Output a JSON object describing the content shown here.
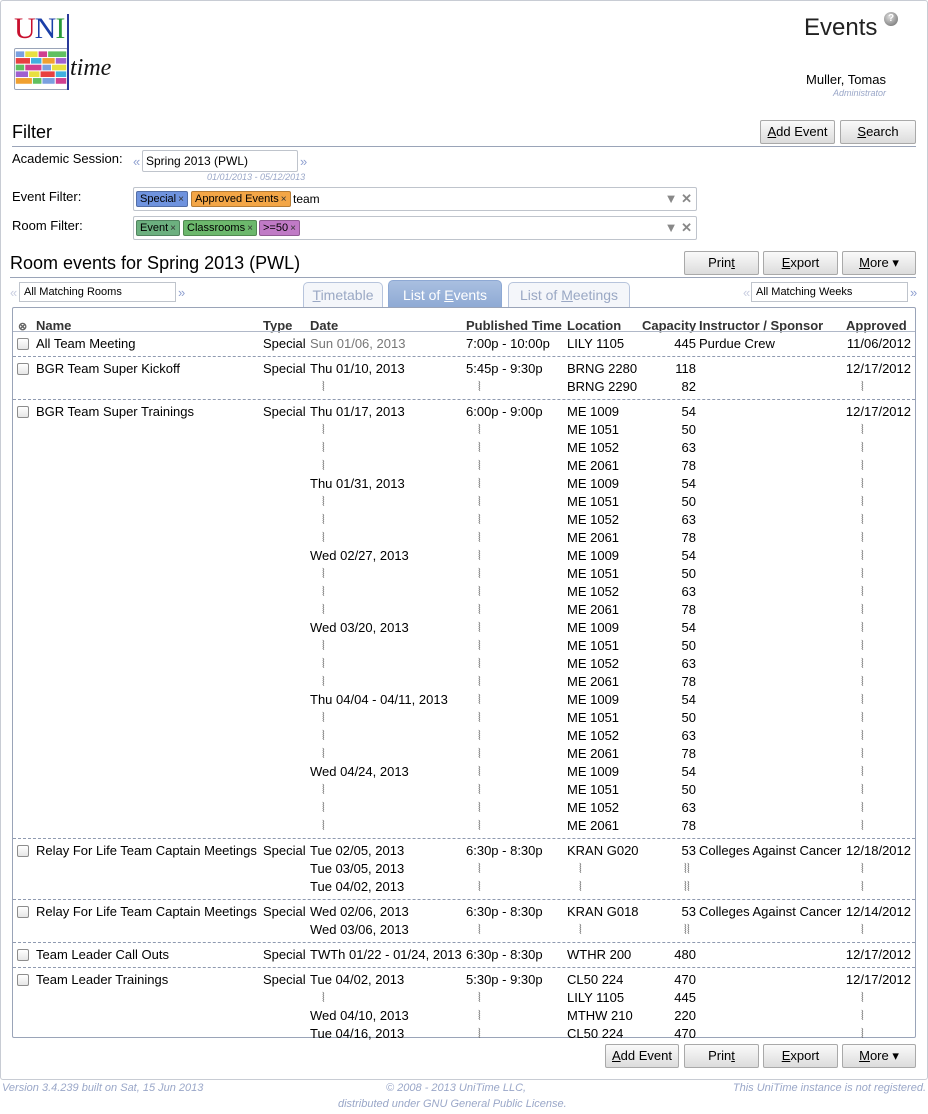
{
  "header": {
    "logo_uni": "UNI",
    "logo_time": "time",
    "title": "Events",
    "help_glyph": "?",
    "user_name": "Muller, Tomas",
    "user_role": "Administrator"
  },
  "filter": {
    "title": "Filter",
    "add_event": "Add Event",
    "search": "Search",
    "session_label": "Academic Session:",
    "session_value": "Spring 2013 (PWL)",
    "session_dates": "01/01/2013 - 05/12/2013",
    "event_filter_label": "Event Filter:",
    "event_chips": [
      {
        "text": "Special",
        "color": "#6f93de"
      },
      {
        "text": "Approved Events",
        "color": "#f3a647"
      }
    ],
    "event_text": "team",
    "room_filter_label": "Room Filter:",
    "room_chips": [
      {
        "text": "Event",
        "color": "#6cb07f"
      },
      {
        "text": "Classrooms",
        "color": "#6cb86c"
      },
      {
        "text": ">=50",
        "color": "#c07ac6"
      }
    ]
  },
  "results": {
    "title": "Room events for Spring 2013 (PWL)",
    "print": "Print",
    "export": "Export",
    "more": "More ▾",
    "rooms_select": "All Matching Rooms",
    "weeks_select": "All Matching Weeks",
    "tabs": [
      "Timetable",
      "List of Events",
      "List of Meetings"
    ],
    "active_tab": 1,
    "columns": [
      "Name",
      "Type",
      "Date",
      "Published Time",
      "Location",
      "Capacity",
      "Instructor / Sponsor",
      "Approved"
    ],
    "ditto": "⦚"
  },
  "events": [
    {
      "name": "All Team Meeting",
      "type": "Special",
      "sponsor": "Purdue Crew",
      "approved": "11/06/2012",
      "meetings": [
        {
          "date": "Sun 01/06, 2013",
          "date_past": true,
          "time": "7:00p - 10:00p",
          "location": "LILY 1105",
          "capacity": "445"
        }
      ]
    },
    {
      "name": "BGR Team Super Kickoff",
      "type": "Special",
      "sponsor": "",
      "approved": "12/17/2012",
      "meetings": [
        {
          "date": "Thu 01/10, 2013",
          "time": "5:45p - 9:30p",
          "location": "BRNG 2280",
          "capacity": "118"
        },
        {
          "date": "",
          "time": "",
          "location": "BRNG 2290",
          "capacity": "82"
        }
      ]
    },
    {
      "name": "BGR Team Super Trainings",
      "type": "Special",
      "sponsor": "",
      "approved": "12/17/2012",
      "meetings": [
        {
          "date": "Thu 01/17, 2013",
          "time": "6:00p - 9:00p",
          "location": "ME 1009",
          "capacity": "54"
        },
        {
          "date": "",
          "time": "",
          "location": "ME 1051",
          "capacity": "50"
        },
        {
          "date": "",
          "time": "",
          "location": "ME 1052",
          "capacity": "63"
        },
        {
          "date": "",
          "time": "",
          "location": "ME 2061",
          "capacity": "78"
        },
        {
          "date": "Thu 01/31, 2013",
          "time": "",
          "location": "ME 1009",
          "capacity": "54"
        },
        {
          "date": "",
          "time": "",
          "location": "ME 1051",
          "capacity": "50"
        },
        {
          "date": "",
          "time": "",
          "location": "ME 1052",
          "capacity": "63"
        },
        {
          "date": "",
          "time": "",
          "location": "ME 2061",
          "capacity": "78"
        },
        {
          "date": "Wed 02/27, 2013",
          "time": "",
          "location": "ME 1009",
          "capacity": "54"
        },
        {
          "date": "",
          "time": "",
          "location": "ME 1051",
          "capacity": "50"
        },
        {
          "date": "",
          "time": "",
          "location": "ME 1052",
          "capacity": "63"
        },
        {
          "date": "",
          "time": "",
          "location": "ME 2061",
          "capacity": "78"
        },
        {
          "date": "Wed 03/20, 2013",
          "time": "",
          "location": "ME 1009",
          "capacity": "54"
        },
        {
          "date": "",
          "time": "",
          "location": "ME 1051",
          "capacity": "50"
        },
        {
          "date": "",
          "time": "",
          "location": "ME 1052",
          "capacity": "63"
        },
        {
          "date": "",
          "time": "",
          "location": "ME 2061",
          "capacity": "78"
        },
        {
          "date": "Thu 04/04 - 04/11, 2013",
          "time": "",
          "location": "ME 1009",
          "capacity": "54"
        },
        {
          "date": "",
          "time": "",
          "location": "ME 1051",
          "capacity": "50"
        },
        {
          "date": "",
          "time": "",
          "location": "ME 1052",
          "capacity": "63"
        },
        {
          "date": "",
          "time": "",
          "location": "ME 2061",
          "capacity": "78"
        },
        {
          "date": "Wed 04/24, 2013",
          "time": "",
          "location": "ME 1009",
          "capacity": "54"
        },
        {
          "date": "",
          "time": "",
          "location": "ME 1051",
          "capacity": "50"
        },
        {
          "date": "",
          "time": "",
          "location": "ME 1052",
          "capacity": "63"
        },
        {
          "date": "",
          "time": "",
          "location": "ME 2061",
          "capacity": "78"
        }
      ]
    },
    {
      "name": "Relay For Life Team Captain Meetings",
      "type": "Special",
      "sponsor": "Colleges Against Cancer",
      "approved": "12/18/2012",
      "meetings": [
        {
          "date": "Tue 02/05, 2013",
          "time": "6:30p - 8:30p",
          "location": "KRAN G020",
          "capacity": "53"
        },
        {
          "date": "Tue 03/05, 2013",
          "time": "",
          "location": "",
          "capacity": ""
        },
        {
          "date": "Tue 04/02, 2013",
          "time": "",
          "location": "",
          "capacity": ""
        }
      ]
    },
    {
      "name": "Relay For Life Team Captain Meetings",
      "type": "Special",
      "sponsor": "Colleges Against Cancer",
      "approved": "12/14/2012",
      "meetings": [
        {
          "date": "Wed 02/06, 2013",
          "time": "6:30p - 8:30p",
          "location": "KRAN G018",
          "capacity": "53"
        },
        {
          "date": "Wed 03/06, 2013",
          "time": "",
          "location": "",
          "capacity": ""
        }
      ]
    },
    {
      "name": "Team Leader Call Outs",
      "type": "Special",
      "sponsor": "",
      "approved": "12/17/2012",
      "meetings": [
        {
          "date": "TWTh 01/22 - 01/24, 2013",
          "time": "6:30p - 8:30p",
          "location": "WTHR 200",
          "capacity": "480"
        }
      ]
    },
    {
      "name": "Team Leader Trainings",
      "type": "Special",
      "sponsor": "",
      "approved": "12/17/2012",
      "meetings": [
        {
          "date": "Tue 04/02, 2013",
          "time": "5:30p - 9:30p",
          "location": "CL50 224",
          "capacity": "470"
        },
        {
          "date": "",
          "time": "",
          "location": "LILY 1105",
          "capacity": "445"
        },
        {
          "date": "Wed 04/10, 2013",
          "time": "",
          "location": "MTHW 210",
          "capacity": "220"
        },
        {
          "date": "Tue 04/16, 2013",
          "time": "",
          "location": "CL50 224",
          "capacity": "470"
        }
      ]
    }
  ],
  "footer": {
    "version": "Version 3.4.239 built on Sat, 15 Jun 2013",
    "copyright": "© 2008 - 2013 UniTime LLC,",
    "license": "distributed under GNU General Public License.",
    "registration": "This UniTime instance is not registered."
  }
}
